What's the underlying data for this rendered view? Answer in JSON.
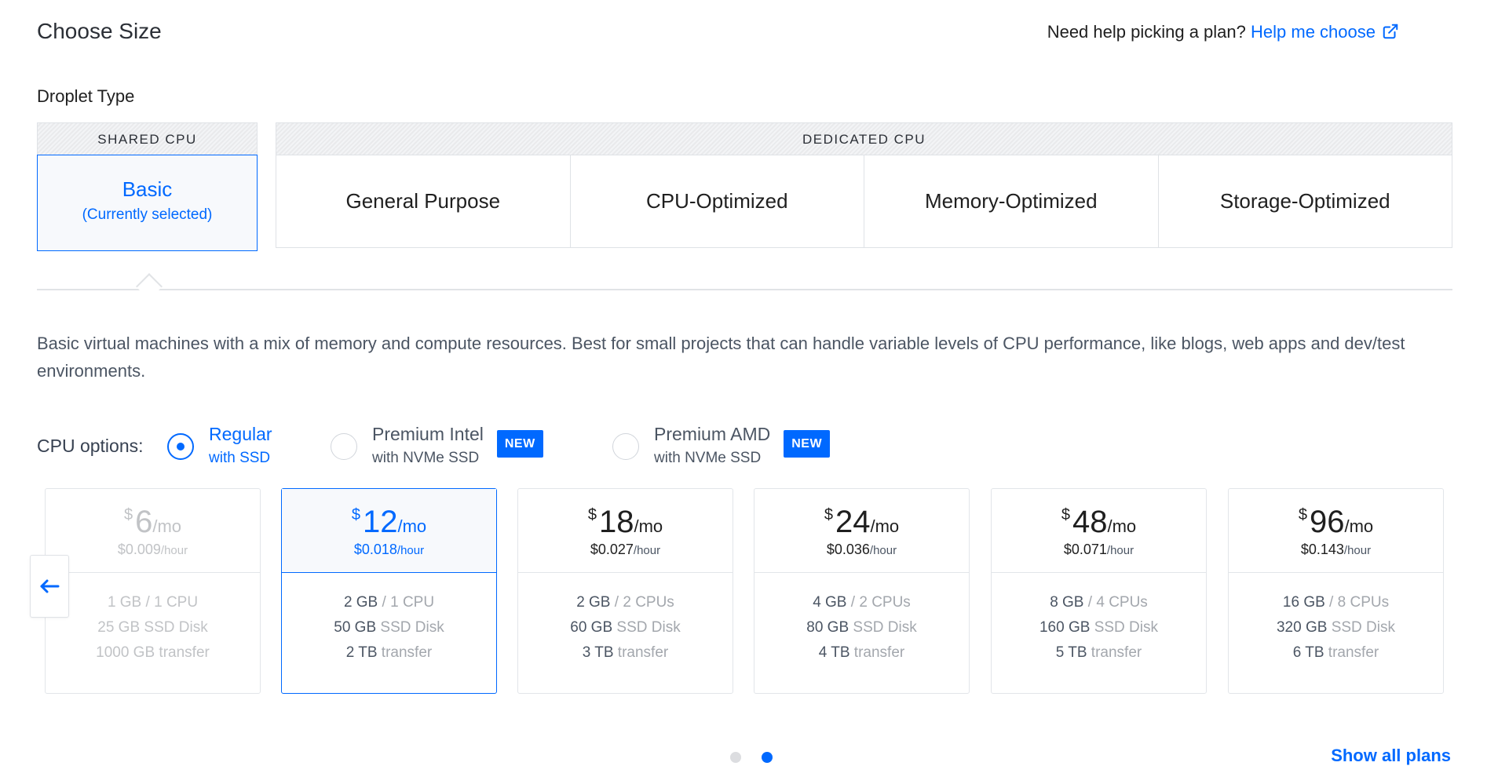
{
  "header": {
    "title": "Choose Size",
    "help_text": "Need help picking a plan?",
    "help_link": "Help me choose",
    "help_icon": "external-link-icon"
  },
  "droplet_type": {
    "label": "Droplet Type",
    "shared_header": "SHARED CPU",
    "dedicated_header": "DEDICATED CPU",
    "basic": {
      "name": "Basic",
      "sub": "(Currently selected)"
    },
    "dedicated_options": [
      "General Purpose",
      "CPU-Optimized",
      "Memory-Optimized",
      "Storage-Optimized"
    ]
  },
  "description": "Basic virtual machines with a mix of memory and compute resources. Best for small projects that can handle variable levels of CPU performance, like blogs, web apps and dev/test environments.",
  "cpu_options": {
    "label": "CPU options:",
    "options": [
      {
        "title": "Regular",
        "sub": "with SSD",
        "selected": true,
        "badge": ""
      },
      {
        "title": "Premium Intel",
        "sub": "with NVMe SSD",
        "selected": false,
        "badge": "NEW"
      },
      {
        "title": "Premium AMD",
        "sub": "with NVMe SSD",
        "selected": false,
        "badge": "NEW"
      }
    ]
  },
  "plans": [
    {
      "currency": "$",
      "amount": "6",
      "per": "/mo",
      "hourly": "$0.009",
      "hourly_unit": "/hour",
      "mem": "1 GB",
      "mem_sep": " / ",
      "cpu": "1 CPU",
      "disk": "25 GB",
      "disk_label": " SSD Disk",
      "transfer": "1000 GB",
      "transfer_label": " transfer",
      "state": "dim"
    },
    {
      "currency": "$",
      "amount": "12",
      "per": "/mo",
      "hourly": "$0.018",
      "hourly_unit": "/hour",
      "mem": "2 GB",
      "mem_sep": " / ",
      "cpu": "1 CPU",
      "disk": "50 GB",
      "disk_label": " SSD Disk",
      "transfer": "2 TB",
      "transfer_label": " transfer",
      "state": "selected"
    },
    {
      "currency": "$",
      "amount": "18",
      "per": "/mo",
      "hourly": "$0.027",
      "hourly_unit": "/hour",
      "mem": "2 GB",
      "mem_sep": " / ",
      "cpu": "2 CPUs",
      "disk": "60 GB",
      "disk_label": " SSD Disk",
      "transfer": "3 TB",
      "transfer_label": " transfer",
      "state": "normal"
    },
    {
      "currency": "$",
      "amount": "24",
      "per": "/mo",
      "hourly": "$0.036",
      "hourly_unit": "/hour",
      "mem": "4 GB",
      "mem_sep": " / ",
      "cpu": "2 CPUs",
      "disk": "80 GB",
      "disk_label": " SSD Disk",
      "transfer": "4 TB",
      "transfer_label": " transfer",
      "state": "normal"
    },
    {
      "currency": "$",
      "amount": "48",
      "per": "/mo",
      "hourly": "$0.071",
      "hourly_unit": "/hour",
      "mem": "8 GB",
      "mem_sep": " / ",
      "cpu": "4 CPUs",
      "disk": "160 GB",
      "disk_label": " SSD Disk",
      "transfer": "5 TB",
      "transfer_label": " transfer",
      "state": "normal"
    },
    {
      "currency": "$",
      "amount": "96",
      "per": "/mo",
      "hourly": "$0.143",
      "hourly_unit": "/hour",
      "mem": "16 GB",
      "mem_sep": " / ",
      "cpu": "8 CPUs",
      "disk": "320 GB",
      "disk_label": " SSD Disk",
      "transfer": "6 TB",
      "transfer_label": " transfer",
      "state": "normal"
    }
  ],
  "nav": {
    "prev_icon": "arrow-left-icon",
    "page_count": 2,
    "active_page": 2
  },
  "footer": {
    "show_all": "Show all plans"
  },
  "colors": {
    "accent": "#0069ff",
    "border": "#dfe2e6",
    "muted": "#a3a7ad"
  }
}
